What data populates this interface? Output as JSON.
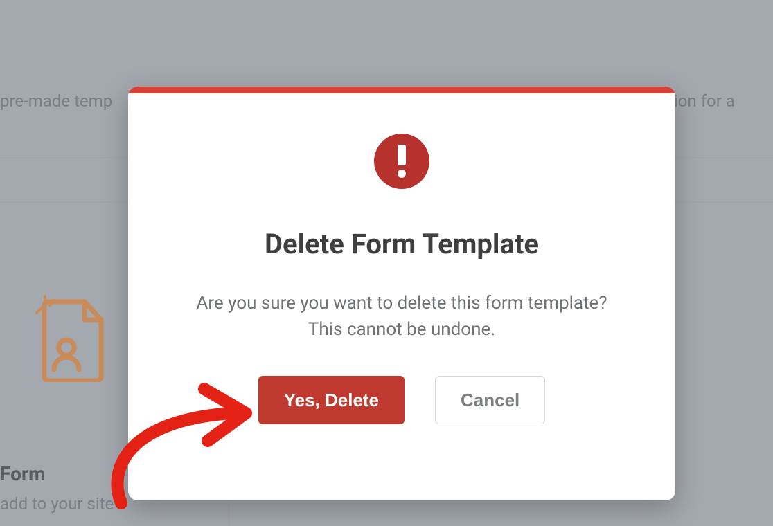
{
  "background": {
    "text_left": "pre-made temp",
    "text_right": "estion for a",
    "card_title": "Form",
    "card_sub": "add to your site's"
  },
  "modal": {
    "title": "Delete Form Template",
    "message": "Are you sure you want to delete this form template? This cannot be undone.",
    "confirm_label": "Yes, Delete",
    "cancel_label": "Cancel"
  }
}
